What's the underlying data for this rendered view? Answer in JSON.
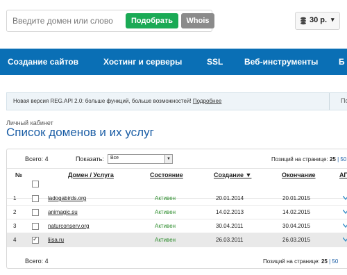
{
  "search": {
    "placeholder": "Введите домен или слово",
    "pick_label": "Подобрать",
    "whois_label": "Whois"
  },
  "balance": {
    "amount": "30 р.",
    "caret": "▾"
  },
  "nav": [
    "Создание сайтов",
    "Хостинг и серверы",
    "SSL",
    "Веб-инструменты",
    "Б"
  ],
  "notice": {
    "text": "Новая версия REG.API 2.0: больше функций, больше возможностей!",
    "link": "Подробнее",
    "rest": "По"
  },
  "breadcrumb": "Личный кабинет",
  "page_title": "Список доменов и их услуг",
  "toolbar": {
    "total_label": "Всего: 4",
    "show_label": "Показать:",
    "show_value": "Все",
    "perpage_label": "Позиций на странице:",
    "perpage_value": "25",
    "perpage_more": "| 50"
  },
  "table": {
    "headers": {
      "num": "№",
      "domain": "Домен / Услуга",
      "status": "Состояние",
      "created": "Создание ▼",
      "expires": "Окончание",
      "api": "АП"
    },
    "rows": [
      {
        "num": "1",
        "domain": "ladogabirds.org",
        "status": "Активен",
        "created": "20.01.2014",
        "expires": "20.01.2015",
        "checked": false
      },
      {
        "num": "2",
        "domain": "animagic.su",
        "status": "Активен",
        "created": "14.02.2013",
        "expires": "14.02.2015",
        "checked": false
      },
      {
        "num": "3",
        "domain": "naturconserv.org",
        "status": "Активен",
        "created": "30.04.2011",
        "expires": "30.04.2015",
        "checked": false
      },
      {
        "num": "4",
        "domain": "liisa.ru",
        "status": "Активен",
        "created": "26.03.2011",
        "expires": "26.03.2015",
        "checked": true
      }
    ]
  },
  "footer": {
    "total_label": "Всего: 4",
    "perpage_label": "Позиций на странице:",
    "perpage_value": "25",
    "perpage_more": "| 50"
  },
  "colors": {
    "nav_bg": "#0a6fb5",
    "title": "#1a5da5",
    "active_status": "#2c8c2c",
    "pick_button": "#1aaa55",
    "whois_button": "#8b8b8b"
  },
  "icons": {
    "balance": "coins-icon",
    "row_action": "arrow-down-icon"
  }
}
